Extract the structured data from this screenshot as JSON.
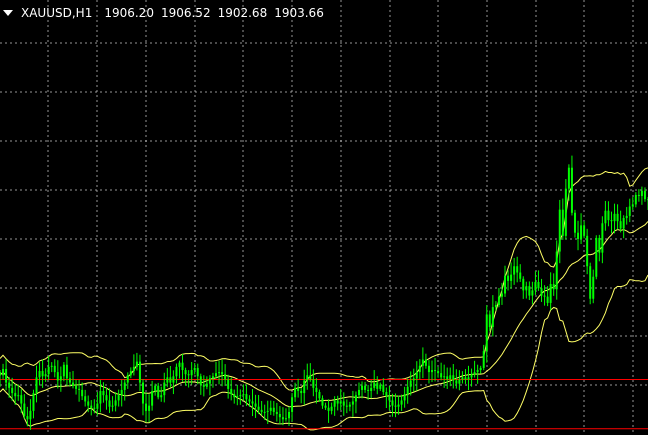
{
  "header": {
    "collapse_icon": "triangle-down-icon",
    "symbol_timeframe": "XAUUSD,H1",
    "open": "1906.20",
    "high": "1906.52",
    "low": "1902.68",
    "close": "1903.66"
  },
  "colors": {
    "background": "#000000",
    "grid": "#c8c8c8",
    "candle": "#00ff00",
    "bollinger": "#ffff66",
    "level_lines": "#ff0000"
  },
  "chart_data": {
    "type": "candlestick",
    "indicators": [
      "bollinger_bands"
    ],
    "grid": true,
    "horizontal_levels": [
      1903.3,
      1898.6
    ],
    "y_range": [
      1898.0,
      1939.5
    ],
    "close_series": [
      1903.7,
      1904.3,
      1903.0,
      1902.5,
      1902.0,
      1901.7,
      1901.8,
      1901.0,
      1899.8,
      1899.5,
      1900.3,
      1902.0,
      1903.5,
      1904.1,
      1903.6,
      1903.8,
      1904.5,
      1904.6,
      1904.0,
      1903.2,
      1903.6,
      1904.7,
      1903.4,
      1903.0,
      1902.7,
      1902.4,
      1902.3,
      1901.7,
      1901.2,
      1900.8,
      1900.6,
      1900.5,
      1901.0,
      1902.2,
      1901.8,
      1901.3,
      1900.7,
      1900.8,
      1901.3,
      1901.8,
      1902.3,
      1903.0,
      1903.7,
      1904.1,
      1904.5,
      1905.0,
      1903.0,
      1901.0,
      1900.3,
      1900.8,
      1902.2,
      1902.7,
      1901.6,
      1901.8,
      1903.0,
      1903.5,
      1903.0,
      1903.6,
      1904.5,
      1904.9,
      1904.2,
      1903.8,
      1903.7,
      1904.2,
      1904.4,
      1903.6,
      1902.8,
      1902.6,
      1902.9,
      1903.4,
      1903.6,
      1903.9,
      1904.0,
      1903.8,
      1903.3,
      1902.4,
      1901.9,
      1901.6,
      1901.7,
      1901.8,
      1901.9,
      1901.4,
      1901.2,
      1901.0,
      1900.7,
      1900.4,
      1900.2,
      1900.2,
      1900.3,
      1900.6,
      1900.2,
      1900.0,
      1899.7,
      1899.5,
      1899.6,
      1900.2,
      1901.6,
      1902.5,
      1902.2,
      1902.0,
      1903.2,
      1903.7,
      1903.3,
      1902.5,
      1902.1,
      1901.5,
      1900.8,
      1900.6,
      1900.3,
      1900.7,
      1901.3,
      1901.0,
      1901.2,
      1900.8,
      1900.7,
      1900.9,
      1901.2,
      1901.8,
      1902.3,
      1902.7,
      1902.3,
      1902.2,
      1902.5,
      1903.0,
      1902.4,
      1902.8,
      1902.1,
      1901.7,
      1901.3,
      1900.8,
      1900.7,
      1900.9,
      1901.3,
      1901.9,
      1902.6,
      1903.2,
      1903.4,
      1904.0,
      1904.6,
      1905.2,
      1904.6,
      1904.0,
      1904.2,
      1904.1,
      1903.9,
      1903.5,
      1903.6,
      1903.3,
      1903.7,
      1903.2,
      1902.9,
      1903.3,
      1903.5,
      1903.3,
      1903.5,
      1903.8,
      1904.0,
      1904.2,
      1904.4,
      1906.0,
      1909.5,
      1908.3,
      1910.2,
      1910.4,
      1911.2,
      1911.5,
      1913.2,
      1912.7,
      1913.3,
      1914.1,
      1913.5,
      1912.9,
      1911.8,
      1912.2,
      1911.3,
      1911.8,
      1912.6,
      1912.0,
      1911.3,
      1911.2,
      1910.6,
      1912.4,
      1911.9,
      1915.5,
      1919.5,
      1917.0,
      1921.5,
      1923.5,
      1919.2,
      1917.3,
      1916.7,
      1918.0,
      1917.0,
      1914.1,
      1911.0,
      1913.1,
      1916.8,
      1915.4,
      1918.2,
      1919.4,
      1918.5,
      1918.4,
      1919.1,
      1918.4,
      1917.7,
      1918.7,
      1918.9,
      1919.8,
      1920.0,
      1920.9,
      1920.8,
      1921.3,
      1920.5,
      1920.5
    ]
  }
}
